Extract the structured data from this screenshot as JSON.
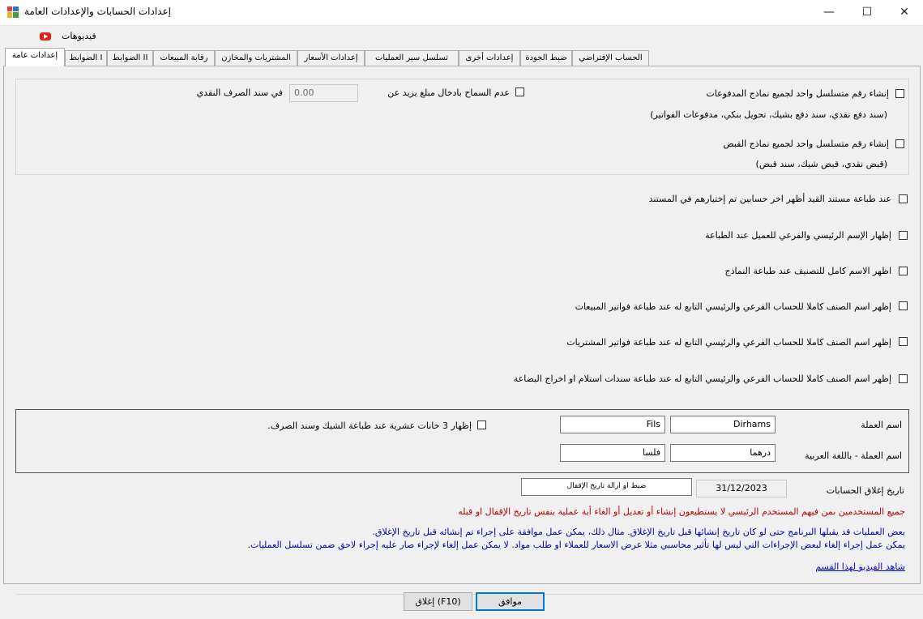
{
  "window": {
    "title": "إعدادات الحسابات والإعدادات العامة",
    "minimize_glyph": "—",
    "maximize_glyph": "☐",
    "close_glyph": "✕"
  },
  "menu": {
    "videos_label": "فيديوهات",
    "videos_icon": "youtube-icon"
  },
  "tabs": [
    {
      "label": "الحساب الإفتراضي"
    },
    {
      "label": "ضبط الجودة"
    },
    {
      "label": "إعدادات أخرى"
    },
    {
      "label": "تسلسل سير العمليات"
    },
    {
      "label": "إعدادات الأسعار"
    },
    {
      "label": "المشتريات والمخازن"
    },
    {
      "label": "رقابة المبيعات"
    },
    {
      "label": "الضوابط II"
    },
    {
      "label": "الضوابط I"
    },
    {
      "label": "إعدادات عامة",
      "active": true
    }
  ],
  "payments": {
    "unified_payments_label": "إنشاء رقم متسلسل واحد لجميع نماذج المدفوعات",
    "unified_payments_hint": "(سند دفع نقدي، سند دفع بشيك، تحويل بنكي، مدفوعات الفواتير)",
    "unified_receipts_label": "إنشاء رقم متسلسل واحد لجميع نماذج القبض",
    "unified_receipts_hint": "(قبض نقدي، قبض شيك، سند قبض)",
    "limit_label": "عدم السماح بادخال مبلغ يزيد عن",
    "limit_value": "0.00",
    "limit_suffix": "في سند الصرف النقدي"
  },
  "options": [
    "عند طباعة مستند القيد أظهر اخر حسابين تم إختيارهم في المستند",
    "إظهار الإسم الرئيسي والفرعي للعميل عند الطباعة",
    "اظهر الاسم كامل للتصنيف عند طباعة النماذج",
    "إظهر اسم الصنف كاملا للحساب الفرعي والرئيسي التابع له عند طباعة فواتير المبيعات",
    "إظهر اسم الصنف كاملا للحساب الفرعي والرئيسي التابع له عند طباعة فواتير المشتريات",
    "إظهر اسم الصنف كاملا للحساب الفرعي والرئيسي التابع له عند طباعة سندات استلام او اخراج البضاعة"
  ],
  "currency": {
    "name_label": "اسم العملة",
    "name_major": "Dirhams",
    "name_minor": "Fils",
    "arabic_label": "اسم العملة - باللغة العربية",
    "arabic_major": "درهما",
    "arabic_minor": "فلسا",
    "decimals_label": "إظهار 3 خانات عشرية عند طباعة الشيك وسند الصرف."
  },
  "closing": {
    "label": "تاريخ إغلاق الحسابات",
    "date": "31/12/2023",
    "set_button": "ضبط او ازالة تاريخ الإقفال",
    "warning": "جميع المستخدمين بمن فيهم المستخدم الرئيسي لا يستطيعون إنشاء أو تعديل أو الغاء أية عملية بنفس تاريخ الإقفال او قبله",
    "info1": "بعض العمليات قد يقبلها البرنامج حتى لو كان تاريخ إنشائها قبل تاريخ الإغلاق. مثال ذلك، يمكن عمل موافقة على إجراء تم إنشائه قبل تاريخ الإغلاق.",
    "info2": "يمكن عمل إجراء إلغاء لبعض الإجراءات التي ليس لها تأثير محاسبي مثلا عرض الاسعار للعملاء او طلب مواد. لا يمكن عمل إلغاء لإجراء صار عليه إجراء لاحق ضمن تسلسل العمليات.",
    "video_link": "شاهد الفيديو لهذا القسم"
  },
  "footer": {
    "ok": "موافق",
    "close": "إغلاق (F10)"
  }
}
